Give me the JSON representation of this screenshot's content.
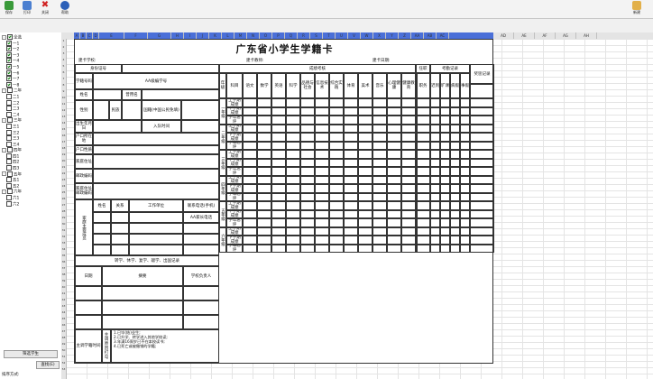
{
  "toolbar": {
    "buttons": [
      "保存",
      "打印",
      "关闭",
      "帮助"
    ],
    "right_button": "新建"
  },
  "tree": {
    "root": "全选",
    "items": [
      "一1",
      "一2",
      "一3",
      "一4",
      "一5",
      "一6",
      "一7",
      "一8",
      "二年",
      "二1",
      "二2",
      "二3",
      "二4",
      "三年",
      "三1",
      "三2",
      "三3",
      "三4",
      "四年",
      "四1",
      "四2",
      "四3",
      "五年",
      "五1",
      "五2",
      "六年",
      "六1",
      "六2"
    ]
  },
  "left_panel": {
    "filter_button": "筛选学生",
    "search_button": "查找(E)",
    "method_label": "排序方式:"
  },
  "sheet": {
    "columns": [
      "A",
      "B",
      "C",
      "D",
      "E",
      "F",
      "G",
      "H",
      "I",
      "J",
      "K",
      "L",
      "M",
      "N",
      "O",
      "P",
      "Q",
      "R",
      "S",
      "T",
      "U",
      "V",
      "W",
      "X",
      "Y",
      "Z",
      "AA",
      "AB",
      "AC",
      "AD",
      "AE",
      "AF",
      "AG",
      "AH"
    ]
  },
  "card": {
    "title": "广东省小学生学籍卡",
    "school": "建卡学校:",
    "teacher": "建卡教师:",
    "date": "建卡日期:",
    "id_label": "身份证号",
    "scores_label": "成绩考核",
    "post_label": "任职",
    "attend_label": "考勤记录",
    "reward_label": "奖惩记录",
    "student_no_label": "学籍号码",
    "student_no_hint": "AA级编学号",
    "grade_label": "年级",
    "subject_label": "科目",
    "subjects": [
      "语文",
      "数学",
      "英语",
      "科学",
      "品德与社会",
      "信息技术",
      "综合实践",
      "体育",
      "美术",
      "音乐",
      "心理健康",
      "健康教育"
    ],
    "post_col": "职务",
    "attend_cols": [
      "迟到",
      "旷课",
      "病假",
      "事假"
    ],
    "name_label": "姓名",
    "used_name_label": "曾用名",
    "sex_label": "性别",
    "nation_label": "民族",
    "nationality_label": "国籍(中国公民免填)",
    "birth_label": "出生年月日",
    "entry_label": "入队时间",
    "hukou_label": "户口所在地",
    "hukou_type_label": "户口性质",
    "address_label": "家庭住址",
    "postcode_label": "邮政编码",
    "phone_label": "家庭住址邮政编码",
    "family_label": "家庭主要成员",
    "member_cols": [
      "姓名",
      "关系",
      "工作单位",
      "联系电话(手机)"
    ],
    "parent_hint": "AA家长电话",
    "transfer_label": "转学、休学、复学、辍学、出国记录",
    "date_col": "日期",
    "reason_col": "摘要",
    "leader_col": "学校负责人",
    "grades": [
      "一年级",
      "二年级",
      "三年级",
      "四年级",
      "五年级",
      "六年级"
    ],
    "term_rows": [
      "上学期成绩",
      "下学期成绩",
      "学年总评"
    ],
    "main_teacher_label": "主调学籍时间",
    "main_reason_label": "主调原因打勾",
    "reasons": [
      "1.已毕(结)业生;",
      "2.已升学、转学进入其他学校读;",
      "3.年满16周岁已不在本校读书;",
      "4.已死亡或被撤销的学籍;"
    ]
  }
}
